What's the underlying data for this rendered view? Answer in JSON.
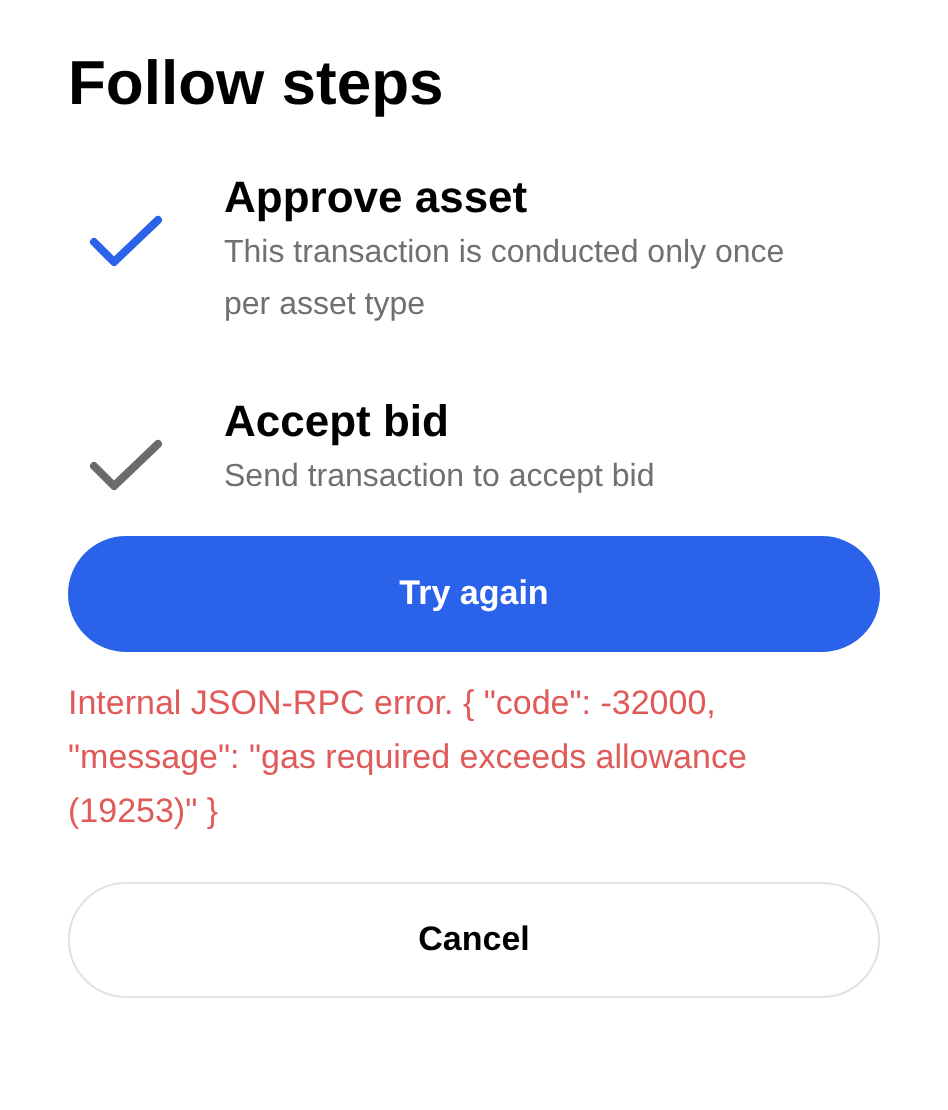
{
  "title": "Follow steps",
  "steps": [
    {
      "title": "Approve asset",
      "description": "This transaction is conducted only once per asset type",
      "completed": true
    },
    {
      "title": "Accept bid",
      "description": "Send transaction to accept bid",
      "completed": false
    }
  ],
  "primary_button": "Try again",
  "error": "Internal JSON-RPC error. { \"code\": -32000, \"message\": \"gas required exceeds allowance (19253)\" }",
  "secondary_button": "Cancel"
}
